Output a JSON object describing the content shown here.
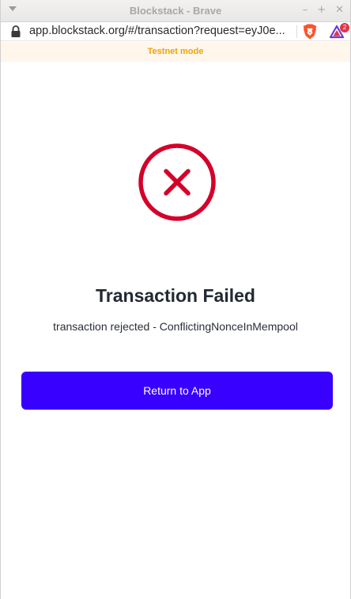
{
  "window": {
    "title": "Blockstack - Brave",
    "controls": [
      "–",
      "+",
      "✕"
    ]
  },
  "addressbar": {
    "url": "app.blockstack.org/#/transaction?request=eyJ0e...",
    "rewards_badge": "2"
  },
  "banner": {
    "text": "Testnet mode"
  },
  "result": {
    "title": "Transaction Failed",
    "message": "transaction rejected - ConflictingNonceInMempool",
    "button_label": "Return to App"
  },
  "colors": {
    "error": "#d4002a",
    "button": "#3700ff",
    "banner_text": "#f0a400",
    "banner_bg": "#fff6ec"
  }
}
